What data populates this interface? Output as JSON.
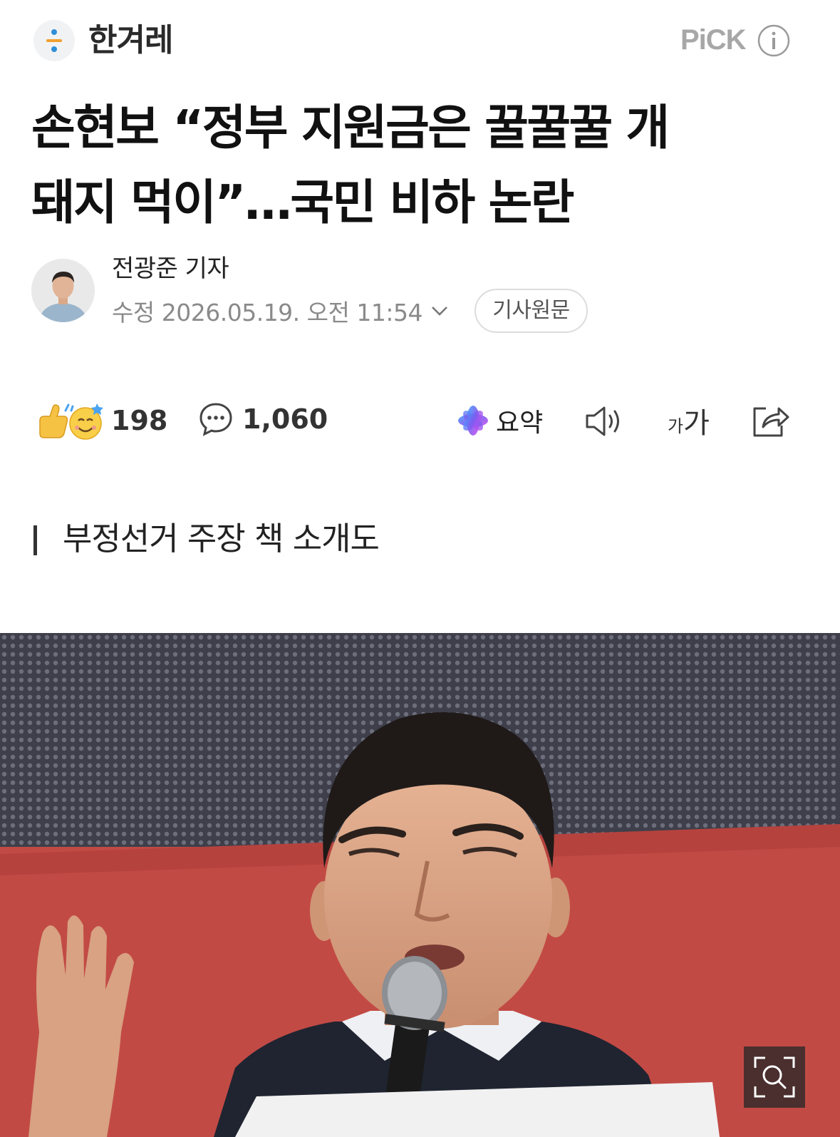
{
  "header": {
    "press_name": "한겨레",
    "pick_label": "PiCK"
  },
  "headline": {
    "line1": "손현보 “정부 지원금은 꿀꿀꿀 개",
    "line2": "돼지 먹이”…국민 비하 논란"
  },
  "byline": {
    "reporter": "전광준 기자",
    "date_prefix": "수정",
    "date": "2026.05.19. 오전 11:54",
    "original_link": "기사원문"
  },
  "actions": {
    "reaction_count": "198",
    "comment_count": "1,060",
    "summary_label": "요약",
    "font_small": "가",
    "font_big": "가"
  },
  "subheading": "부정선거 주장 책 소개도",
  "icons": {
    "info": "info-icon",
    "chevron": "chevron-down-icon",
    "reaction": "reaction-emoji-icon",
    "comment": "comment-bubble-icon",
    "summary": "ai-summary-icon",
    "speaker": "speaker-icon",
    "share": "share-icon",
    "zoom": "zoom-icon"
  },
  "colors": {
    "pick_gray": "#a7a7a7",
    "meta_gray": "#8a8a8a",
    "photo_red": "#c24a45",
    "summary_purple": "#7b5cf0"
  }
}
